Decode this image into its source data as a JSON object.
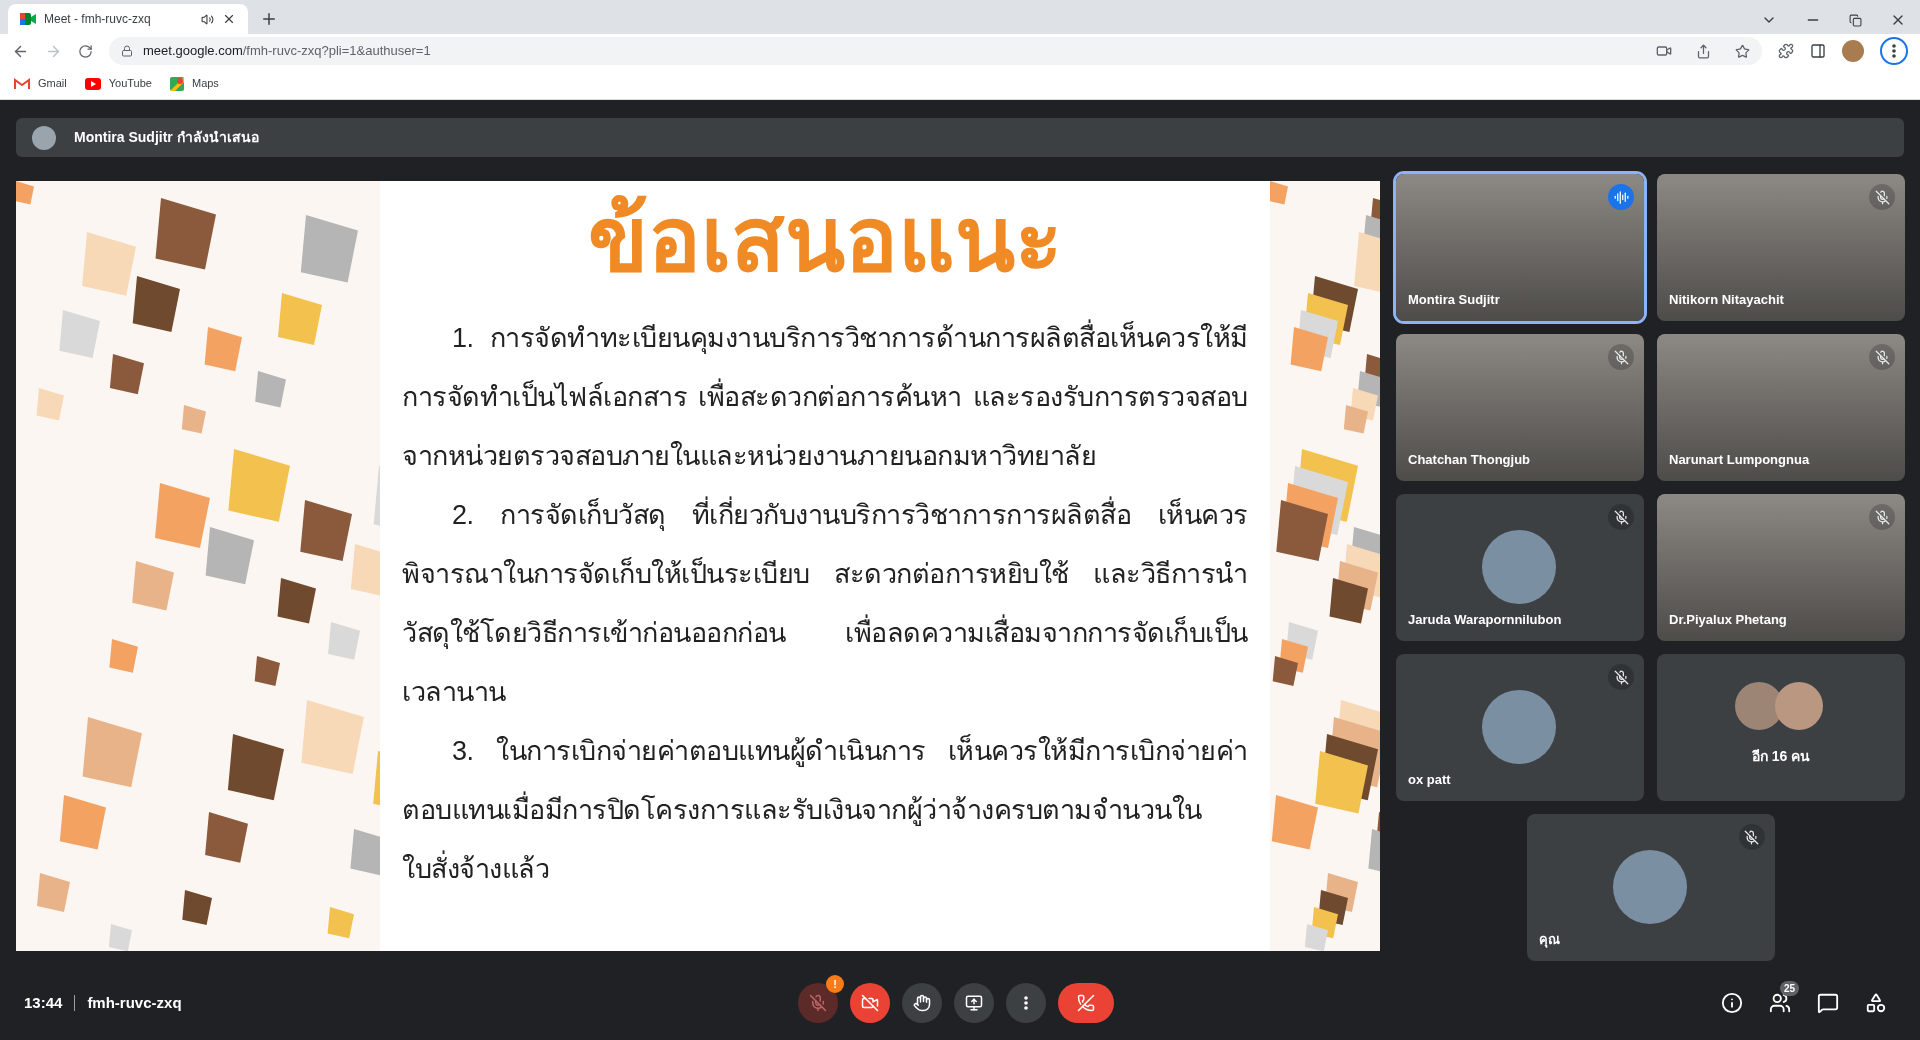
{
  "browser": {
    "tab": {
      "title": "Meet - fmh-ruvc-zxq",
      "audio_playing": true
    },
    "url": {
      "host": "meet.google.com",
      "path": "/fmh-ruvc-zxq?pli=1&authuser=1"
    },
    "bookmarks": [
      {
        "kind": "gmail",
        "label": "Gmail"
      },
      {
        "kind": "youtube",
        "label": "YouTube"
      },
      {
        "kind": "maps",
        "label": "Maps"
      }
    ]
  },
  "presenter_bar": {
    "name": "Montira Sudjitr",
    "status": "กำลังนำเสนอ"
  },
  "slide": {
    "title": "ข้อเสนอแนะ",
    "paragraphs": [
      "1. การจัดทำทะเบียนคุมงานบริการวิชาการด้านการผลิตสื่อเห็นควรให้มีการจัดทำเป็นไฟล์เอกสาร เพื่อสะดวกต่อการค้นหา และรองรับการตรวจสอบจากหน่วยตรวจสอบภายในและหน่วยงานภายนอกมหาวิทยาลัย",
      "2. การจัดเก็บวัสดุ ที่เกี่ยวกับงานบริการวิชาการการผลิตสื่อ เห็นควรพิจารณาในการจัดเก็บให้เป็นระเบียบ สะดวกต่อการหยิบใช้ และวิธีการนำวัสดุใช้โดยวิธีการเข้าก่อนออกก่อน เพื่อลดความเสื่อมจากการจัดเก็บเป็นเวลานาน",
      "3. ในการเบิกจ่ายค่าตอบแทนผู้ดำเนินการ เห็นควรให้มีการเบิกจ่ายค่าตอบแทนเมื่อมีการปิดโครงการและรับเงินจากผู้ว่าจ้างครบตามจำนวนในใบสั่งจ้างแล้ว"
    ]
  },
  "tiles": [
    {
      "kind": "video",
      "name": "Montira Sudjitr",
      "muted": false,
      "speaking": true
    },
    {
      "kind": "video",
      "name": "Nitikorn Nitayachit",
      "muted": true,
      "speaking": false
    },
    {
      "kind": "video",
      "name": "Chatchan Thongjub",
      "muted": true,
      "speaking": false
    },
    {
      "kind": "video",
      "name": "Narunart Lumpongnua",
      "muted": true,
      "speaking": false
    },
    {
      "kind": "avatar",
      "name": "Jaruda Warapornnilubon",
      "muted": true,
      "speaking": false
    },
    {
      "kind": "video",
      "name": "Dr.Piyalux Phetang",
      "muted": true,
      "speaking": false
    },
    {
      "kind": "avatar",
      "name": "ox patt",
      "muted": true,
      "speaking": false
    },
    {
      "kind": "group",
      "name": "อีก 16 คน",
      "muted": false,
      "speaking": false
    },
    {
      "kind": "avatar",
      "name": "คุณ",
      "muted": true,
      "speaking": false
    }
  ],
  "bottom_bar": {
    "time": "13:44",
    "meeting_code": "fmh-ruvc-zxq",
    "controls": [
      {
        "kind": "mic",
        "on": false,
        "badge": "!"
      },
      {
        "kind": "camera",
        "on": false
      },
      {
        "kind": "hand"
      },
      {
        "kind": "present"
      },
      {
        "kind": "more"
      },
      {
        "kind": "leave"
      }
    ],
    "side_buttons": [
      {
        "kind": "info"
      },
      {
        "kind": "people",
        "badge": "25"
      },
      {
        "kind": "chat"
      },
      {
        "kind": "activities"
      }
    ]
  }
}
